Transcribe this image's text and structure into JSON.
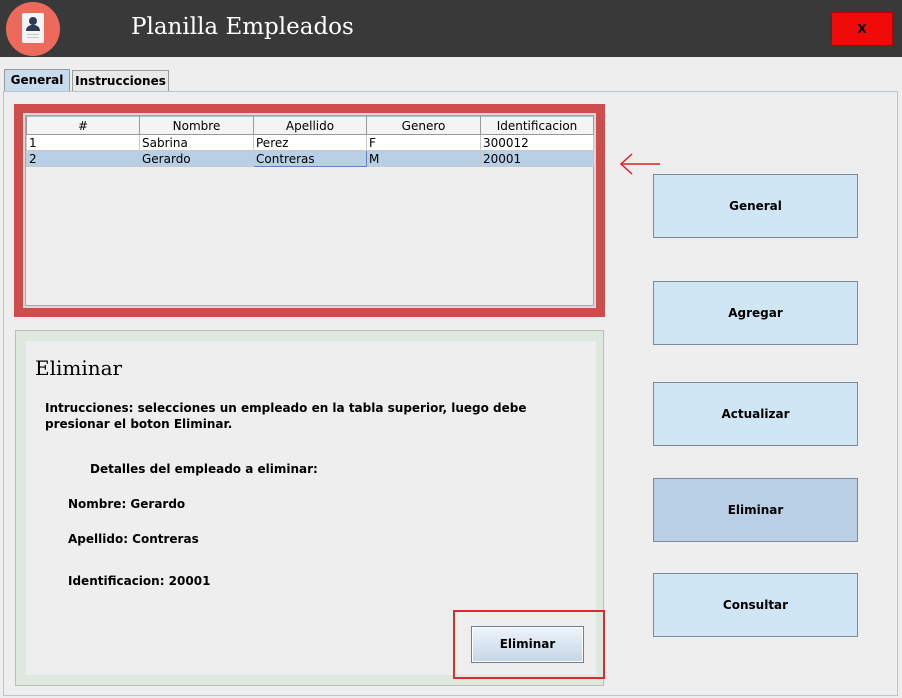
{
  "window": {
    "title": "Planilla Empleados",
    "close_label": "X",
    "app_icon": "employee-document-icon"
  },
  "tabs": [
    {
      "label": "General",
      "active": true
    },
    {
      "label": "Instrucciones",
      "active": false
    }
  ],
  "table": {
    "columns": [
      "#",
      "Nombre",
      "Apellido",
      "Genero",
      "Identificacion"
    ],
    "rows": [
      [
        "1",
        "Sabrina",
        "Perez",
        "F",
        "300012"
      ],
      [
        "2",
        "Gerardo",
        "Contreras",
        "M",
        "20001"
      ]
    ],
    "selected_row": 2
  },
  "arrow_icon": "arrow-left-icon",
  "nav_buttons": [
    "General",
    "Agregar",
    "Actualizar",
    "Eliminar",
    "Consultar"
  ],
  "active_nav": "Eliminar",
  "panel": {
    "title": "Eliminar",
    "instructions": "Intrucciones: selecciones un empleado en la tabla superior, luego debe presionar el boton Eliminar.",
    "details_header": "Detalles del empleado a eliminar:",
    "nombre": "Nombre: Gerardo",
    "apellido": "Apellido: Contreras",
    "identificacion": "Identificacion: 20001",
    "button_label": "Eliminar"
  },
  "colors": {
    "titlebar": "#393939",
    "close_button": "#f10a0a",
    "table_highlight": "#cd4c4c",
    "button_fill": "#d1e6f5",
    "selected_fill": "#b8cfe5"
  }
}
